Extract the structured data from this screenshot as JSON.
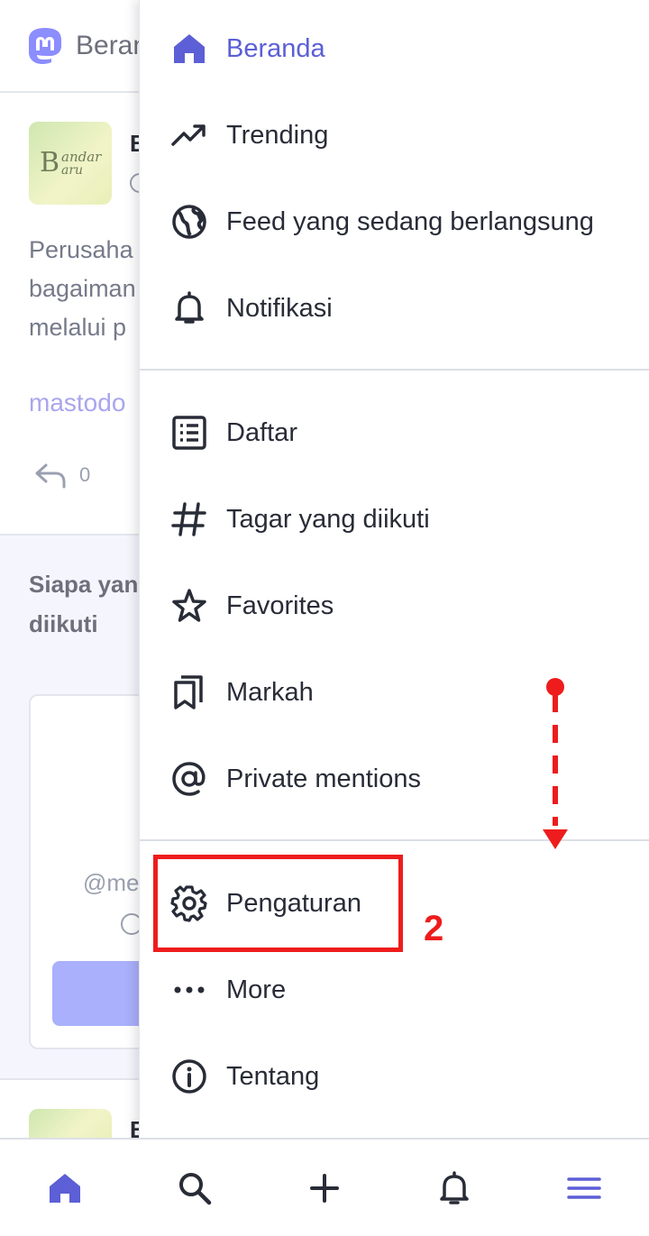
{
  "background": {
    "header_title": "Beranda",
    "post": {
      "avatar_text_big": "B",
      "avatar_text_top": "andar",
      "avatar_text_bottom": "aru",
      "author": "B",
      "text": "Perusaha\nbagaiman\nmelalui p",
      "link": "mastodo",
      "reply_count": "0"
    },
    "suggestions": {
      "title": "Siapa yang\ndiikuti",
      "handle": "@me"
    },
    "post2_author": "B"
  },
  "drawer": {
    "items": [
      {
        "label": "Beranda",
        "icon": "home-icon"
      },
      {
        "label": "Trending",
        "icon": "trending-icon"
      },
      {
        "label": "Feed yang sedang berlangsung",
        "icon": "globe-icon"
      },
      {
        "label": "Notifikasi",
        "icon": "bell-icon"
      },
      {
        "label": "Daftar",
        "icon": "list-icon"
      },
      {
        "label": "Tagar yang diikuti",
        "icon": "hashtag-icon"
      },
      {
        "label": "Favorites",
        "icon": "star-icon"
      },
      {
        "label": "Markah",
        "icon": "bookmark-icon"
      },
      {
        "label": "Private mentions",
        "icon": "at-icon"
      },
      {
        "label": "Pengaturan",
        "icon": "gear-icon"
      },
      {
        "label": "More",
        "icon": "more-icon"
      },
      {
        "label": "Tentang",
        "icon": "info-icon"
      }
    ]
  },
  "annotation": {
    "step_number": "2",
    "color": "#ee1c1c"
  },
  "tabbar": {
    "tabs": [
      "home-icon",
      "search-icon",
      "compose-icon",
      "notifications-icon",
      "menu-icon"
    ],
    "active": "menu-icon"
  },
  "colors": {
    "accent": "#5c5fd5",
    "text": "#282c37",
    "muted": "#757a8a"
  }
}
